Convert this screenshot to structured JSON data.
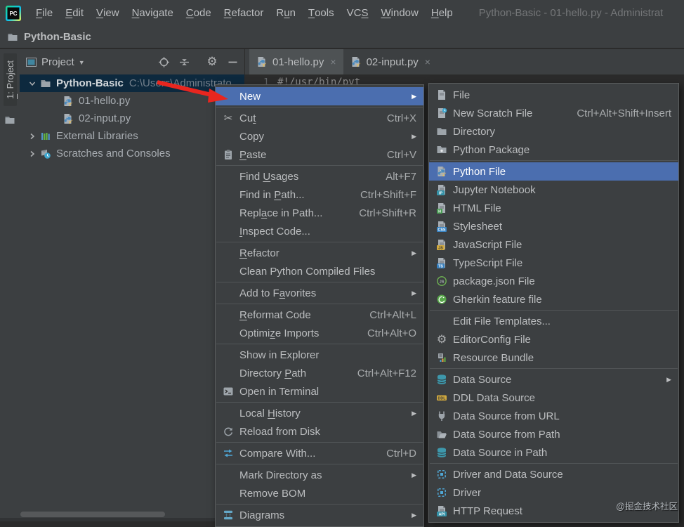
{
  "colors": {
    "accent": "#4B6EAF",
    "menu_bg": "#3C3F41",
    "tree_selection": "#0D293E",
    "arrow_red": "#E8261F",
    "editor_bg": "#2B2B2B"
  },
  "titlebar": {
    "title": "Python-Basic - 01-hello.py - Administrat",
    "menus": [
      {
        "label": "File",
        "u": "F"
      },
      {
        "label": "Edit",
        "u": "E"
      },
      {
        "label": "View",
        "u": "V"
      },
      {
        "label": "Navigate",
        "u": "N"
      },
      {
        "label": "Code",
        "u": "C"
      },
      {
        "label": "Refactor",
        "u": "R"
      },
      {
        "label": "Run",
        "u": "u"
      },
      {
        "label": "Tools",
        "u": "T"
      },
      {
        "label": "VCS",
        "u": "S"
      },
      {
        "label": "Window",
        "u": "W"
      },
      {
        "label": "Help",
        "u": "H"
      }
    ]
  },
  "breadcrumb": {
    "project": "Python-Basic"
  },
  "tool_window_bar": {
    "label": "1: Project",
    "u": "1"
  },
  "project_panel": {
    "header": {
      "title": "Project",
      "icons": [
        "locate",
        "collapse-all",
        "divider",
        "settings",
        "hide"
      ]
    },
    "tree": [
      {
        "label": "Python-Basic",
        "path": "C:\\Users\\Administrato",
        "icon": "folder",
        "chevron": "down",
        "selected": true,
        "bold": true,
        "child": false
      },
      {
        "label": "01-hello.py",
        "icon": "python-file",
        "child": true
      },
      {
        "label": "02-input.py",
        "icon": "python-file",
        "child": true
      },
      {
        "label": "External Libraries",
        "icon": "libraries",
        "chevron": "right",
        "child": false
      },
      {
        "label": "Scratches and Consoles",
        "icon": "scratches",
        "chevron": "right",
        "child": false
      }
    ]
  },
  "editor": {
    "tabs": [
      {
        "label": "01-hello.py",
        "icon": "python-file",
        "active": true
      },
      {
        "label": "02-input.py",
        "icon": "python-file",
        "active": false
      }
    ],
    "first_line_number": "1",
    "first_line_code": "#!/usr/bin/pyt"
  },
  "context_menu": {
    "items": [
      {
        "label": "New",
        "selected": true,
        "submenu": true
      },
      {
        "sep": true
      },
      {
        "label": "Cut",
        "u": "t",
        "icon": "cut",
        "shortcut": "Ctrl+X"
      },
      {
        "label": "Copy",
        "submenu": true
      },
      {
        "label": "Paste",
        "u": "P",
        "icon": "paste",
        "shortcut": "Ctrl+V"
      },
      {
        "sep": true
      },
      {
        "label": "Find Usages",
        "u": "U",
        "shortcut": "Alt+F7"
      },
      {
        "label": "Find in Path...",
        "u": "P",
        "shortcut": "Ctrl+Shift+F"
      },
      {
        "label": "Replace in Path...",
        "u": "a",
        "shortcut": "Ctrl+Shift+R"
      },
      {
        "label": "Inspect Code...",
        "u": "I"
      },
      {
        "sep": true
      },
      {
        "label": "Refactor",
        "u": "R",
        "submenu": true
      },
      {
        "label": "Clean Python Compiled Files"
      },
      {
        "sep": true
      },
      {
        "label": "Add to Favorites",
        "u": "a",
        "submenu": true
      },
      {
        "sep": true
      },
      {
        "label": "Reformat Code",
        "u": "R",
        "shortcut": "Ctrl+Alt+L"
      },
      {
        "label": "Optimize Imports",
        "u": "z",
        "shortcut": "Ctrl+Alt+O"
      },
      {
        "sep": true
      },
      {
        "label": "Show in Explorer"
      },
      {
        "label": "Directory Path",
        "u": "P",
        "shortcut": "Ctrl+Alt+F12"
      },
      {
        "label": "Open in Terminal",
        "icon": "terminal"
      },
      {
        "sep": true
      },
      {
        "label": "Local History",
        "u": "H",
        "submenu": true
      },
      {
        "label": "Reload from Disk",
        "icon": "refresh"
      },
      {
        "sep": true
      },
      {
        "label": "Compare With...",
        "icon": "compare",
        "shortcut": "Ctrl+D"
      },
      {
        "sep": true
      },
      {
        "label": "Mark Directory as",
        "submenu": true
      },
      {
        "label": "Remove BOM"
      },
      {
        "sep": true
      },
      {
        "label": "Diagrams",
        "icon": "diagrams",
        "submenu": true
      }
    ]
  },
  "new_submenu": {
    "items": [
      {
        "label": "File",
        "icon": "file"
      },
      {
        "label": "New Scratch File",
        "icon": "scratch-file",
        "shortcut": "Ctrl+Alt+Shift+Insert"
      },
      {
        "label": "Directory",
        "icon": "folder"
      },
      {
        "label": "Python Package",
        "icon": "package"
      },
      {
        "sep": true
      },
      {
        "label": "Python File",
        "icon": "python-file",
        "selected": true
      },
      {
        "label": "Jupyter Notebook",
        "icon": "jupyter"
      },
      {
        "label": "HTML File",
        "icon": "html"
      },
      {
        "label": "Stylesheet",
        "icon": "css"
      },
      {
        "label": "JavaScript File",
        "icon": "js"
      },
      {
        "label": "TypeScript File",
        "icon": "ts"
      },
      {
        "label": "package.json File",
        "icon": "packagejson"
      },
      {
        "label": "Gherkin feature file",
        "icon": "gherkin"
      },
      {
        "sep": true
      },
      {
        "label": "Edit File Templates..."
      },
      {
        "label": "EditorConfig File",
        "icon": "gear"
      },
      {
        "label": "Resource Bundle",
        "icon": "bundle"
      },
      {
        "sep": true
      },
      {
        "label": "Data Source",
        "icon": "database",
        "submenu": true
      },
      {
        "label": "DDL Data Source",
        "icon": "ddl"
      },
      {
        "label": "Data Source from URL",
        "icon": "plug"
      },
      {
        "label": "Data Source from Path",
        "icon": "folder-open"
      },
      {
        "label": "Data Source in Path",
        "icon": "database"
      },
      {
        "sep": true
      },
      {
        "label": "Driver and Data Source",
        "icon": "driver"
      },
      {
        "label": "Driver",
        "icon": "driver"
      },
      {
        "label": "HTTP Request",
        "icon": "api"
      }
    ]
  },
  "watermark": "@掘金技术社区"
}
